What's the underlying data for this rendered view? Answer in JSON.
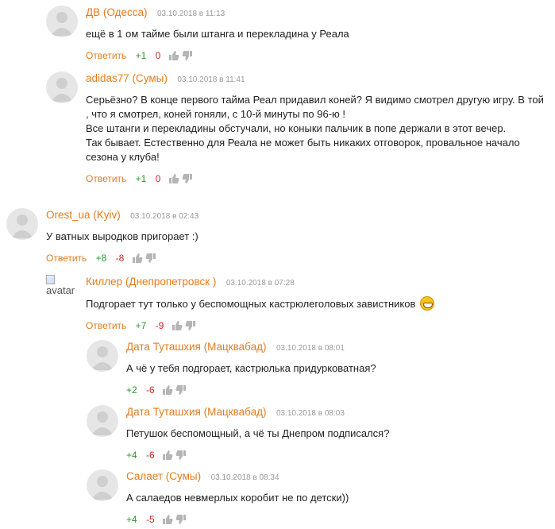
{
  "comments": [
    {
      "author": "ДВ (Одесса)",
      "date": "03.10.2018 в 11:13",
      "text": "ещё в 1 ом тайме были штанга и перекладина у Реала",
      "reply": "Ответить",
      "plus": "+1",
      "minus": "0"
    },
    {
      "author": "adidas77 (Сумы)",
      "date": "03.10.2018 в 11:41",
      "text": "Серьёзно? В конце первого тайма Реал придавил коней? Я видимо смотрел другую игру. В той , что я смотрел, коней гоняли, с 10-й минуты по 96-ю !\nВсе штанги и перекладины обстучали, но коныки пальчик в попе держали в этот вечер.\nТак бывает. Естественно для Реала не может быть никаких отговорок, провальное начало сезона у клуба!",
      "reply": "Ответить",
      "plus": "+1",
      "minus": "0"
    },
    {
      "author": "Orest_ua (Kyiv)",
      "date": "03.10.2018 в 02:43",
      "text": "У ватных выродков пригорает :)",
      "reply": "Ответить",
      "plus": "+8",
      "minus": "-8"
    },
    {
      "author": "Киллер (Днепропетровск )",
      "date": "03.10.2018 в 07:28",
      "text": "Подгорает тут только у беспомощных кастрюлеголовых завистников",
      "avatar_alt": "avatar",
      "reply": "Ответить",
      "plus": "+7",
      "minus": "-9"
    },
    {
      "author": "Дата Туташхия (Мацквабад)",
      "date": "03.10.2018 в 08:01",
      "text": "А чё у тебя подгорает, кастрюлька придурковатная?",
      "plus": "+2",
      "minus": "-6"
    },
    {
      "author": "Дата Туташхия (Мацквабад)",
      "date": "03.10.2018 в 08:03",
      "text": "Петушок беспомощный, а чё ты Днепром подписался?",
      "plus": "+4",
      "minus": "-6"
    },
    {
      "author": "Салает (Сумы)",
      "date": "03.10.2018 в 08:34",
      "text": "А салаедов невмерлых коробит не по детски))",
      "plus": "+4",
      "minus": "-5"
    }
  ]
}
